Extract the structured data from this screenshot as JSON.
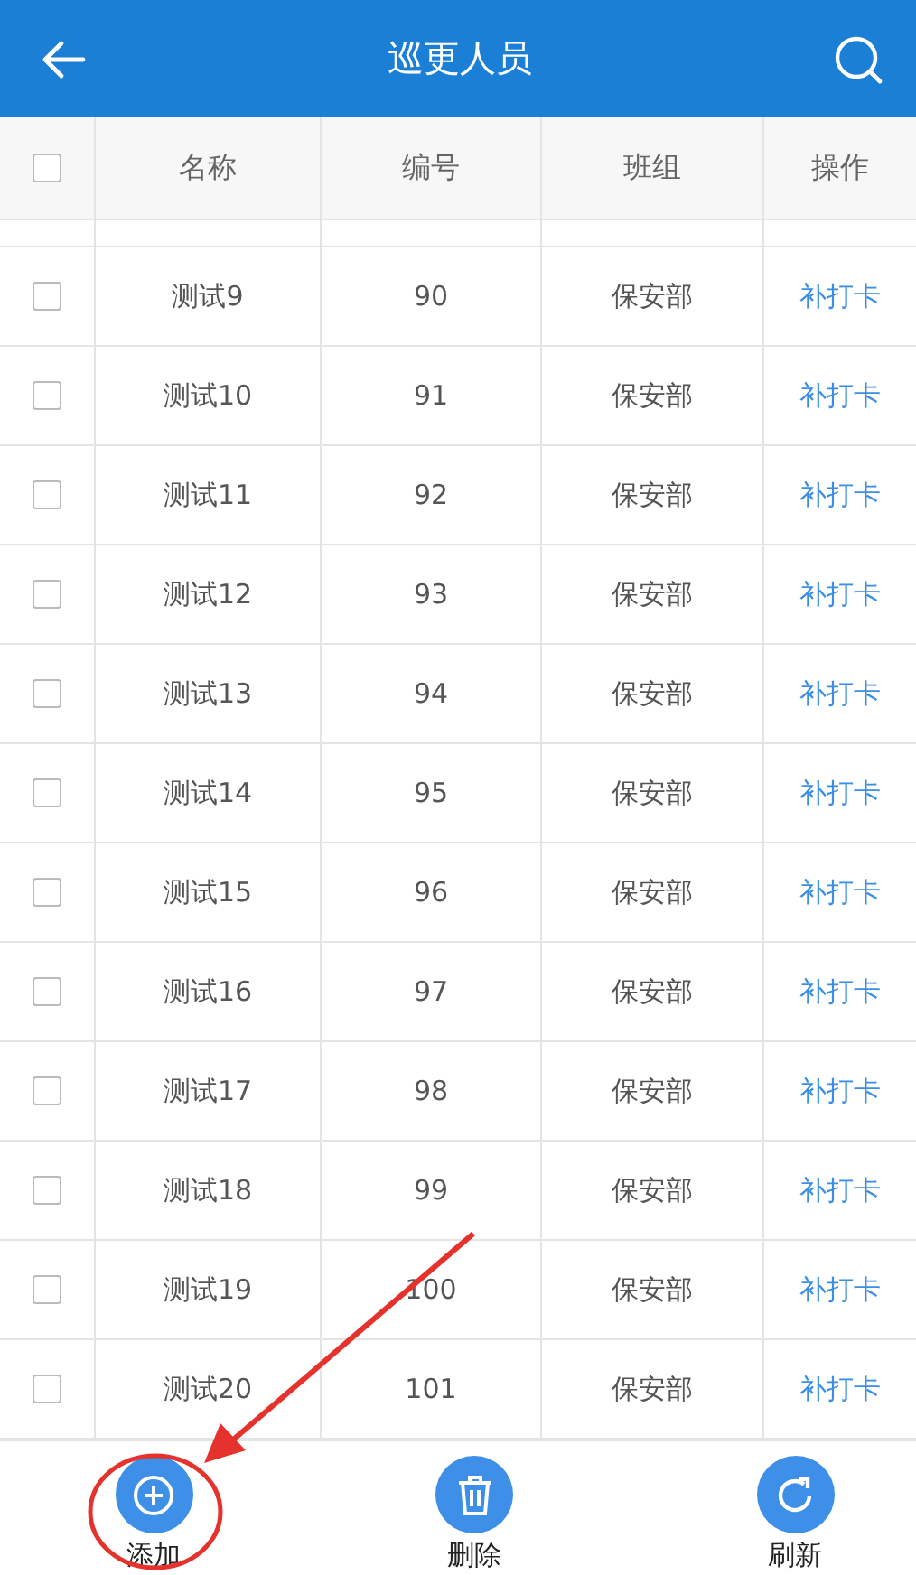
{
  "header": {
    "title": "巡更人员"
  },
  "table": {
    "select_all": {
      "checked": false
    },
    "columns": [
      "名称",
      "编号",
      "班组",
      "操作"
    ],
    "rows": [
      {
        "checked": false,
        "name": "测试9",
        "number": "90",
        "group": "保安部",
        "action": "补打卡"
      },
      {
        "checked": false,
        "name": "测试10",
        "number": "91",
        "group": "保安部",
        "action": "补打卡"
      },
      {
        "checked": false,
        "name": "测试11",
        "number": "92",
        "group": "保安部",
        "action": "补打卡"
      },
      {
        "checked": false,
        "name": "测试12",
        "number": "93",
        "group": "保安部",
        "action": "补打卡"
      },
      {
        "checked": false,
        "name": "测试13",
        "number": "94",
        "group": "保安部",
        "action": "补打卡"
      },
      {
        "checked": false,
        "name": "测试14",
        "number": "95",
        "group": "保安部",
        "action": "补打卡"
      },
      {
        "checked": false,
        "name": "测试15",
        "number": "96",
        "group": "保安部",
        "action": "补打卡"
      },
      {
        "checked": false,
        "name": "测试16",
        "number": "97",
        "group": "保安部",
        "action": "补打卡"
      },
      {
        "checked": false,
        "name": "测试17",
        "number": "98",
        "group": "保安部",
        "action": "补打卡"
      },
      {
        "checked": false,
        "name": "测试18",
        "number": "99",
        "group": "保安部",
        "action": "补打卡"
      },
      {
        "checked": false,
        "name": "测试19",
        "number": "100",
        "group": "保安部",
        "action": "补打卡"
      },
      {
        "checked": false,
        "name": "测试20",
        "number": "101",
        "group": "保安部",
        "action": "补打卡"
      }
    ]
  },
  "toolbar": [
    {
      "kind": "add",
      "label": "添加"
    },
    {
      "kind": "delete",
      "label": "删除"
    },
    {
      "kind": "refresh",
      "label": "刷新"
    }
  ]
}
